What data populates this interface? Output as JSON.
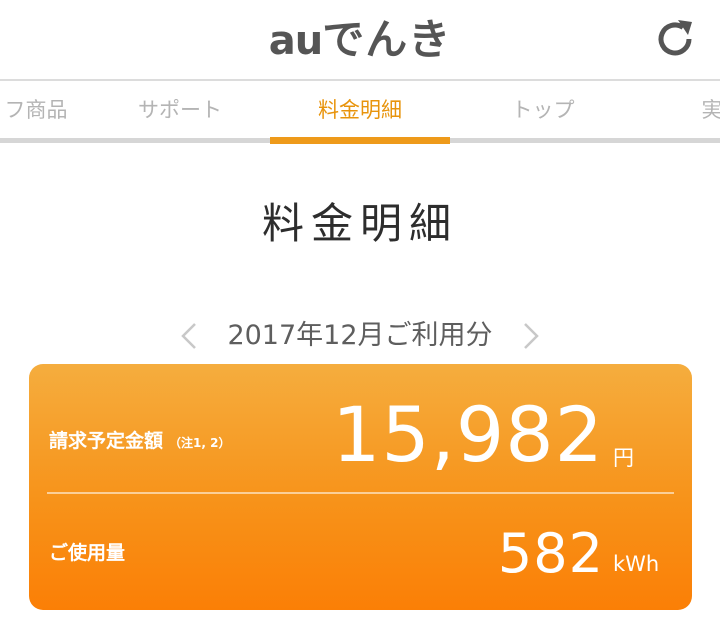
{
  "header": {
    "logo_au": "au",
    "logo_denki": "でんき",
    "refresh_icon": "refresh-icon"
  },
  "tabs": [
    {
      "label": "フ商品",
      "active": false
    },
    {
      "label": "サポート",
      "active": false
    },
    {
      "label": "料金明細",
      "active": true
    },
    {
      "label": "トップ",
      "active": false
    },
    {
      "label": "実",
      "active": false
    }
  ],
  "page": {
    "title": "料金明細"
  },
  "month_nav": {
    "label": "2017年12月ご利用分",
    "prev_icon": "chevron-left-icon",
    "next_icon": "chevron-right-icon"
  },
  "summary": {
    "billing_label": "請求予定金額",
    "billing_note": "（注1, 2）",
    "billing_amount": "15,982",
    "billing_unit": "円",
    "usage_label": "ご使用量",
    "usage_amount": "582",
    "usage_unit": "kWh"
  },
  "colors": {
    "accent": "#ee9a1a",
    "tab_inactive": "#b4b4b4",
    "card_top": "#f5ad3e",
    "card_bottom": "#fb7f06"
  }
}
